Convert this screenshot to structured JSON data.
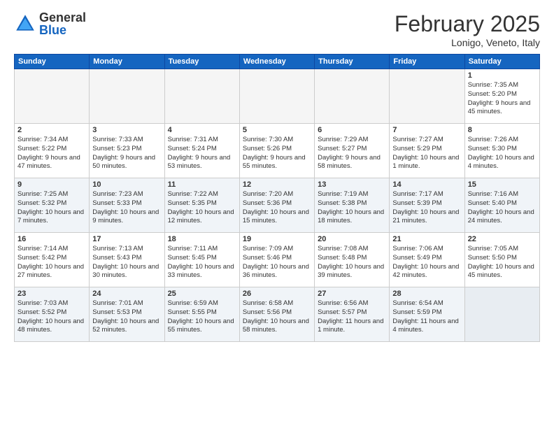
{
  "header": {
    "logo_general": "General",
    "logo_blue": "Blue",
    "month": "February 2025",
    "location": "Lonigo, Veneto, Italy"
  },
  "days_of_week": [
    "Sunday",
    "Monday",
    "Tuesday",
    "Wednesday",
    "Thursday",
    "Friday",
    "Saturday"
  ],
  "weeks": [
    {
      "alt": false,
      "days": [
        {
          "num": "",
          "info": ""
        },
        {
          "num": "",
          "info": ""
        },
        {
          "num": "",
          "info": ""
        },
        {
          "num": "",
          "info": ""
        },
        {
          "num": "",
          "info": ""
        },
        {
          "num": "",
          "info": ""
        },
        {
          "num": "1",
          "info": "Sunrise: 7:35 AM\nSunset: 5:20 PM\nDaylight: 9 hours\nand 45 minutes."
        }
      ]
    },
    {
      "alt": false,
      "days": [
        {
          "num": "2",
          "info": "Sunrise: 7:34 AM\nSunset: 5:22 PM\nDaylight: 9 hours\nand 47 minutes."
        },
        {
          "num": "3",
          "info": "Sunrise: 7:33 AM\nSunset: 5:23 PM\nDaylight: 9 hours\nand 50 minutes."
        },
        {
          "num": "4",
          "info": "Sunrise: 7:31 AM\nSunset: 5:24 PM\nDaylight: 9 hours\nand 53 minutes."
        },
        {
          "num": "5",
          "info": "Sunrise: 7:30 AM\nSunset: 5:26 PM\nDaylight: 9 hours\nand 55 minutes."
        },
        {
          "num": "6",
          "info": "Sunrise: 7:29 AM\nSunset: 5:27 PM\nDaylight: 9 hours\nand 58 minutes."
        },
        {
          "num": "7",
          "info": "Sunrise: 7:27 AM\nSunset: 5:29 PM\nDaylight: 10 hours\nand 1 minute."
        },
        {
          "num": "8",
          "info": "Sunrise: 7:26 AM\nSunset: 5:30 PM\nDaylight: 10 hours\nand 4 minutes."
        }
      ]
    },
    {
      "alt": true,
      "days": [
        {
          "num": "9",
          "info": "Sunrise: 7:25 AM\nSunset: 5:32 PM\nDaylight: 10 hours\nand 7 minutes."
        },
        {
          "num": "10",
          "info": "Sunrise: 7:23 AM\nSunset: 5:33 PM\nDaylight: 10 hours\nand 9 minutes."
        },
        {
          "num": "11",
          "info": "Sunrise: 7:22 AM\nSunset: 5:35 PM\nDaylight: 10 hours\nand 12 minutes."
        },
        {
          "num": "12",
          "info": "Sunrise: 7:20 AM\nSunset: 5:36 PM\nDaylight: 10 hours\nand 15 minutes."
        },
        {
          "num": "13",
          "info": "Sunrise: 7:19 AM\nSunset: 5:38 PM\nDaylight: 10 hours\nand 18 minutes."
        },
        {
          "num": "14",
          "info": "Sunrise: 7:17 AM\nSunset: 5:39 PM\nDaylight: 10 hours\nand 21 minutes."
        },
        {
          "num": "15",
          "info": "Sunrise: 7:16 AM\nSunset: 5:40 PM\nDaylight: 10 hours\nand 24 minutes."
        }
      ]
    },
    {
      "alt": false,
      "days": [
        {
          "num": "16",
          "info": "Sunrise: 7:14 AM\nSunset: 5:42 PM\nDaylight: 10 hours\nand 27 minutes."
        },
        {
          "num": "17",
          "info": "Sunrise: 7:13 AM\nSunset: 5:43 PM\nDaylight: 10 hours\nand 30 minutes."
        },
        {
          "num": "18",
          "info": "Sunrise: 7:11 AM\nSunset: 5:45 PM\nDaylight: 10 hours\nand 33 minutes."
        },
        {
          "num": "19",
          "info": "Sunrise: 7:09 AM\nSunset: 5:46 PM\nDaylight: 10 hours\nand 36 minutes."
        },
        {
          "num": "20",
          "info": "Sunrise: 7:08 AM\nSunset: 5:48 PM\nDaylight: 10 hours\nand 39 minutes."
        },
        {
          "num": "21",
          "info": "Sunrise: 7:06 AM\nSunset: 5:49 PM\nDaylight: 10 hours\nand 42 minutes."
        },
        {
          "num": "22",
          "info": "Sunrise: 7:05 AM\nSunset: 5:50 PM\nDaylight: 10 hours\nand 45 minutes."
        }
      ]
    },
    {
      "alt": true,
      "days": [
        {
          "num": "23",
          "info": "Sunrise: 7:03 AM\nSunset: 5:52 PM\nDaylight: 10 hours\nand 48 minutes."
        },
        {
          "num": "24",
          "info": "Sunrise: 7:01 AM\nSunset: 5:53 PM\nDaylight: 10 hours\nand 52 minutes."
        },
        {
          "num": "25",
          "info": "Sunrise: 6:59 AM\nSunset: 5:55 PM\nDaylight: 10 hours\nand 55 minutes."
        },
        {
          "num": "26",
          "info": "Sunrise: 6:58 AM\nSunset: 5:56 PM\nDaylight: 10 hours\nand 58 minutes."
        },
        {
          "num": "27",
          "info": "Sunrise: 6:56 AM\nSunset: 5:57 PM\nDaylight: 11 hours\nand 1 minute."
        },
        {
          "num": "28",
          "info": "Sunrise: 6:54 AM\nSunset: 5:59 PM\nDaylight: 11 hours\nand 4 minutes."
        },
        {
          "num": "",
          "info": ""
        }
      ]
    }
  ]
}
